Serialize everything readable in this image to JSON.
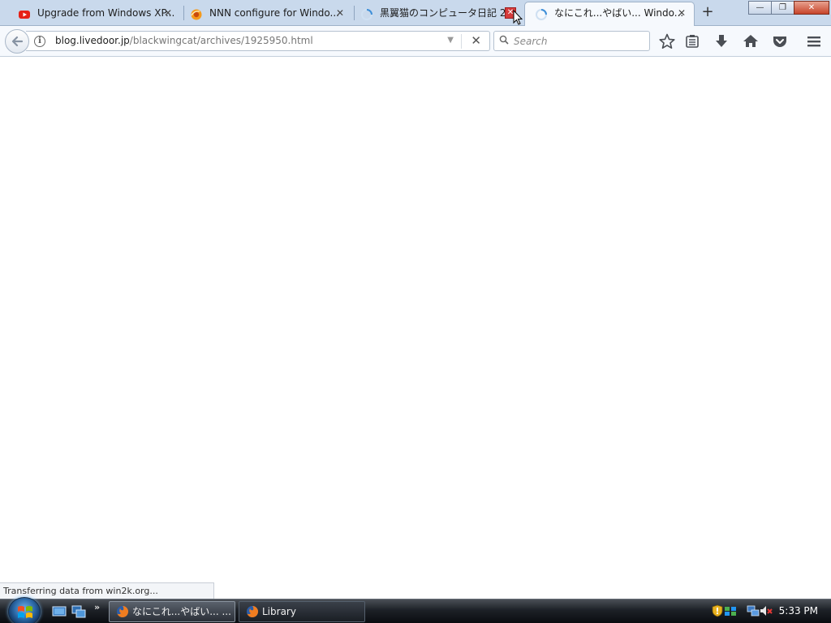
{
  "browser": {
    "tabs": [
      {
        "title": "Upgrade from Windows XP...",
        "favicon": "youtube-icon"
      },
      {
        "title": "NNN configure for Windo...",
        "favicon": "firefox-g-icon"
      },
      {
        "title": "黒翼猫のコンピュータ日記 2...",
        "favicon": "loading-icon"
      },
      {
        "title": "なにこれ...やばい... Windo...",
        "favicon": "loading-icon",
        "selected": true
      }
    ],
    "new_tab_glyph": "+",
    "window_buttons": {
      "minimize": "—",
      "restore": "❐",
      "close": "✕"
    }
  },
  "navbar": {
    "url_host": "blog.livedoor.jp",
    "url_path": "/blackwingcat/archives/1925950.html",
    "search_placeholder": "Search",
    "toolbar_icons": [
      "bookmark-star-icon",
      "reading-list-icon",
      "downloads-icon",
      "home-icon",
      "pocket-icon",
      "menu-icon"
    ]
  },
  "status": {
    "text": "Transferring data from win2k.org..."
  },
  "taskbar": {
    "tasks": [
      {
        "label": "なにこれ...やばい... ..."
      },
      {
        "label": "Library"
      }
    ],
    "quick_launch_chevron": "»",
    "clock": "5:33 PM"
  },
  "colors": {
    "tabstrip": "#c9d9ec",
    "selected_tab": "#f6f9fd",
    "close_hot": "#d63b3b",
    "taskbar": "#1d2127"
  }
}
